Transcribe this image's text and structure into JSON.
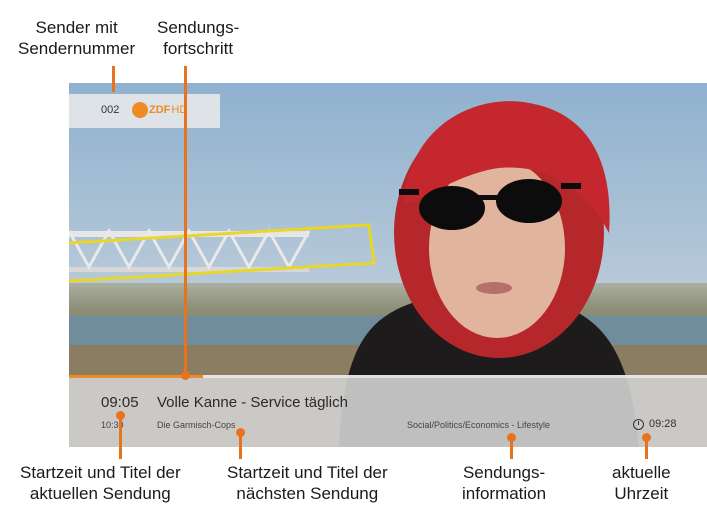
{
  "annotations": {
    "sender": [
      "Sender mit",
      "Sendernummer"
    ],
    "progress": [
      "Sendungs-",
      "fortschritt"
    ],
    "current": [
      "Startzeit und Titel der",
      "aktuellen Sendung"
    ],
    "next": [
      "Startzeit und Titel der",
      "nächsten Sendung"
    ],
    "info": [
      "Sendungs-",
      "information"
    ],
    "clock": [
      "aktuelle",
      "Uhrzeit"
    ]
  },
  "channel": {
    "number": "002",
    "logo_text": "ZDF",
    "logo_hd": "HD"
  },
  "program": {
    "current_start": "09:05",
    "current_title": "Volle Kanne - Service täglich",
    "next_start": "10:30",
    "next_title": "Die Garmisch-Cops",
    "genre": "Social/Politics/Economics - Lifestyle",
    "progress": 0.21
  },
  "clock": {
    "time": "09:28"
  },
  "colors": {
    "accent": "#e8731e",
    "logo": "#f08a24"
  }
}
